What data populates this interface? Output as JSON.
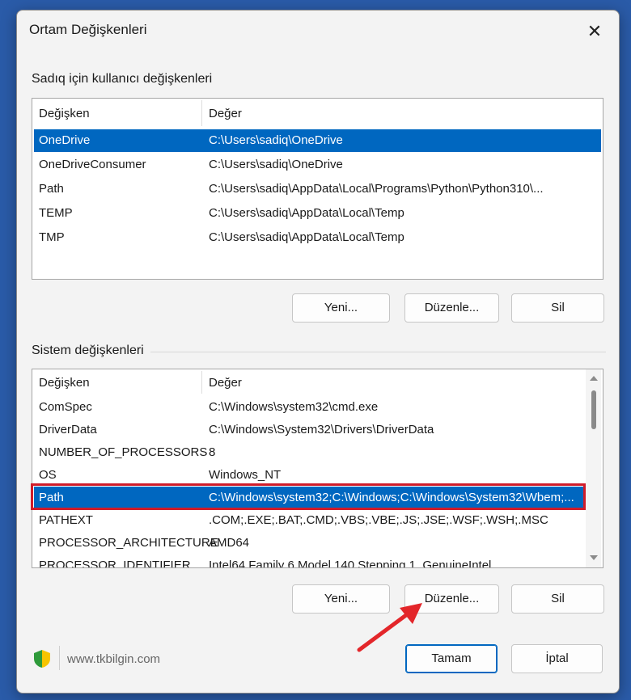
{
  "window": {
    "title": "Ortam Değişkenleri"
  },
  "user_section": {
    "label": "Sadıq için kullanıcı değişkenleri",
    "columns": [
      "Değişken",
      "Değer"
    ],
    "rows": [
      {
        "name": "OneDrive",
        "value": "C:\\Users\\sadiq\\OneDrive",
        "selected": true
      },
      {
        "name": "OneDriveConsumer",
        "value": "C:\\Users\\sadiq\\OneDrive",
        "selected": false
      },
      {
        "name": "Path",
        "value": "C:\\Users\\sadiq\\AppData\\Local\\Programs\\Python\\Python310\\...",
        "selected": false
      },
      {
        "name": "TEMP",
        "value": "C:\\Users\\sadiq\\AppData\\Local\\Temp",
        "selected": false
      },
      {
        "name": "TMP",
        "value": "C:\\Users\\sadiq\\AppData\\Local\\Temp",
        "selected": false
      }
    ],
    "buttons": {
      "new": "Yeni...",
      "edit": "Düzenle...",
      "delete": "Sil"
    }
  },
  "system_section": {
    "label": "Sistem değişkenleri",
    "columns": [
      "Değişken",
      "Değer"
    ],
    "rows": [
      {
        "name": "ComSpec",
        "value": "C:\\Windows\\system32\\cmd.exe",
        "selected": false
      },
      {
        "name": "DriverData",
        "value": "C:\\Windows\\System32\\Drivers\\DriverData",
        "selected": false
      },
      {
        "name": "NUMBER_OF_PROCESSORS",
        "value": "8",
        "selected": false
      },
      {
        "name": "OS",
        "value": "Windows_NT",
        "selected": false
      },
      {
        "name": "Path",
        "value": "C:\\Windows\\system32;C:\\Windows;C:\\Windows\\System32\\Wbem;...",
        "selected": true
      },
      {
        "name": "PATHEXT",
        "value": ".COM;.EXE;.BAT;.CMD;.VBS;.VBE;.JS;.JSE;.WSF;.WSH;.MSC",
        "selected": false
      },
      {
        "name": "PROCESSOR_ARCHITECTURE",
        "value": "AMD64",
        "selected": false
      },
      {
        "name": "PROCESSOR_IDENTIFIER",
        "value": "Intel64 Family 6 Model 140 Stepping 1, GenuineIntel",
        "selected": false
      }
    ],
    "buttons": {
      "new": "Yeni...",
      "edit": "Düzenle...",
      "delete": "Sil"
    }
  },
  "footer": {
    "site": "www.tkbilgin.com",
    "ok": "Tamam",
    "cancel": "İptal"
  },
  "colors": {
    "selection": "#0067c0",
    "highlight_box": "#d01c2a",
    "annotation_arrow": "#e3262a"
  },
  "icons": {
    "close": "close-icon",
    "logo": "shield-logo-icon",
    "annotation": "red-arrow-icon"
  }
}
